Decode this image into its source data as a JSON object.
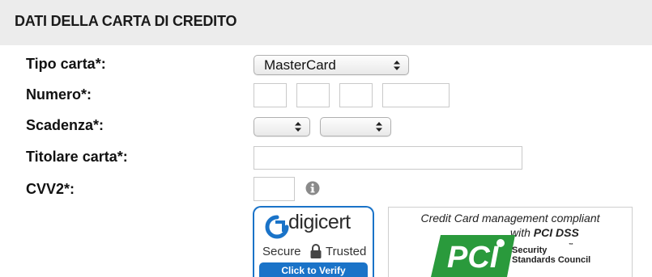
{
  "section": {
    "title": "DATI DELLA CARTA DI CREDITO"
  },
  "form": {
    "card_type": {
      "label": "Tipo carta*:",
      "selected": "MasterCard"
    },
    "number": {
      "label": "Numero*:",
      "parts": [
        "",
        "",
        "",
        ""
      ]
    },
    "expiry": {
      "label": "Scadenza*:",
      "month": "",
      "year": ""
    },
    "holder": {
      "label": "Titolare carta*:",
      "value": ""
    },
    "cvv": {
      "label": "CVV2*:",
      "value": ""
    }
  },
  "badges": {
    "digicert": {
      "brand": "digicert",
      "secure": "Secure",
      "trusted": "Trusted",
      "verify": "Click to Verify"
    },
    "pci": {
      "line1": "Credit Card management compliant",
      "line2_prefix": "with ",
      "line2_bold": "PCI DSS",
      "security": "Security",
      "council": "Standards Council",
      "tm": "™"
    }
  },
  "icons": {
    "info": "info-icon",
    "select_arrows": "select-arrows-icon",
    "lock": "lock-icon"
  },
  "colors": {
    "header_bg": "#ececec",
    "digicert_blue": "#1a73c8",
    "pci_green": "#2a9a3c"
  }
}
